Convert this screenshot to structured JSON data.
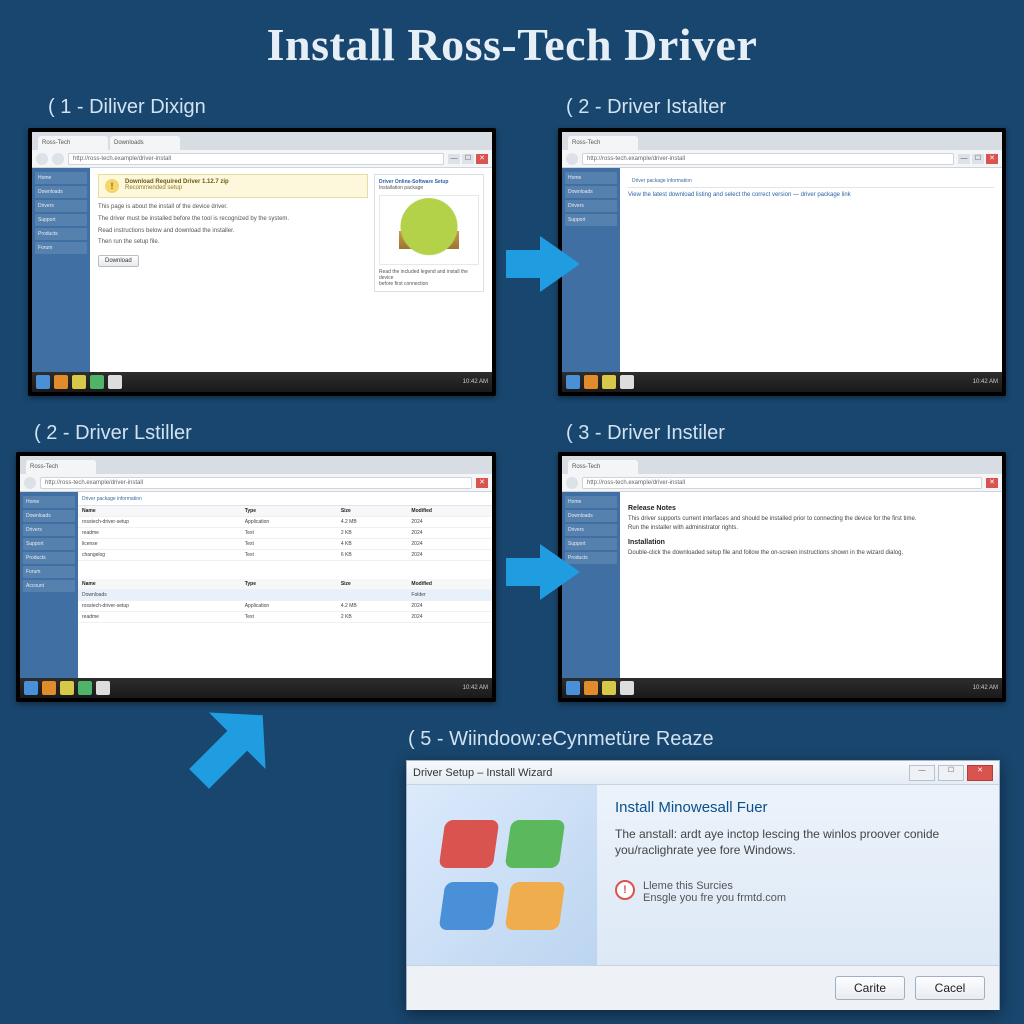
{
  "title": "Install Ross-Tech Driver",
  "steps": {
    "s1": {
      "label": "(  1 - Diliver Dixign"
    },
    "s2a": {
      "label": "(  2 - Driver Istalter"
    },
    "s2b": {
      "label": "(  2 - Driver Lstiller"
    },
    "s3": {
      "label": "(  3 - Driver Instiler"
    },
    "s5": {
      "label": "(  5 - Wiindoow:eCynmetüre Reaze"
    }
  },
  "browser": {
    "tab1": "Ross-Tech",
    "tab2": "Downloads",
    "url": "http://ross-tech.example/driver-install",
    "win_min": "—",
    "win_max": "☐",
    "win_close": "✕"
  },
  "sidebar_items": [
    "Home",
    "Downloads",
    "Drivers",
    "Support",
    "Products",
    "Forum",
    "Account"
  ],
  "step1": {
    "notice_title": "Download Required Driver 1.12.7 zip",
    "notice_sub": "Recommended setup",
    "box_head": "Driver Online-Software Setup",
    "box_sub": "Installation package",
    "box_foot1": "Read the included legend and install the device",
    "box_foot2": "before first connection",
    "p1": "This page is about the install of the device driver.",
    "p2": "The driver must be installed before the tool is recognized by the system.",
    "p3": "Read instructions below and download the installer.",
    "p4": "Then run the setup file.",
    "btn": "Download"
  },
  "step2": {
    "link_line": "View the latest download listing and select the correct version — driver package link",
    "info_line": "Driver package information"
  },
  "step3": {
    "cols": [
      "Name",
      "Type",
      "Size",
      "Modified"
    ],
    "rows": [
      [
        "rosstech-driver-setup",
        "Application",
        "4.2 MB",
        "2024"
      ],
      [
        "readme",
        "Text",
        "2 KB",
        "2024"
      ],
      [
        "license",
        "Text",
        "4 KB",
        "2024"
      ],
      [
        "changelog",
        "Text",
        "6 KB",
        "2024"
      ]
    ],
    "downloads_row": [
      "Downloads",
      "",
      "",
      "Folder"
    ]
  },
  "step4": {
    "h1": "Release Notes",
    "p1": "This driver supports current interfaces and should be installed prior to connecting the device for the first time.",
    "p2": "Run the installer with administrator rights.",
    "h2": "Installation",
    "p3": "Double-click the downloaded setup file and follow the on-screen instructions shown in the wizard dialog."
  },
  "taskbar": {
    "clock": "10:42 AM"
  },
  "dialog": {
    "titlebar": "Driver Setup – Install Wizard",
    "heading": "Install Minowesall Fuer",
    "message": "The anstall: ardt aye inctop lescing the winlos proover conide you/raclighrate yee fore Windows.",
    "warn1": "Lleme this Surcies",
    "warn2": "Ensgle you fre you frmtd.com",
    "btn_primary": "Carite",
    "btn_cancel": "Cacel"
  }
}
